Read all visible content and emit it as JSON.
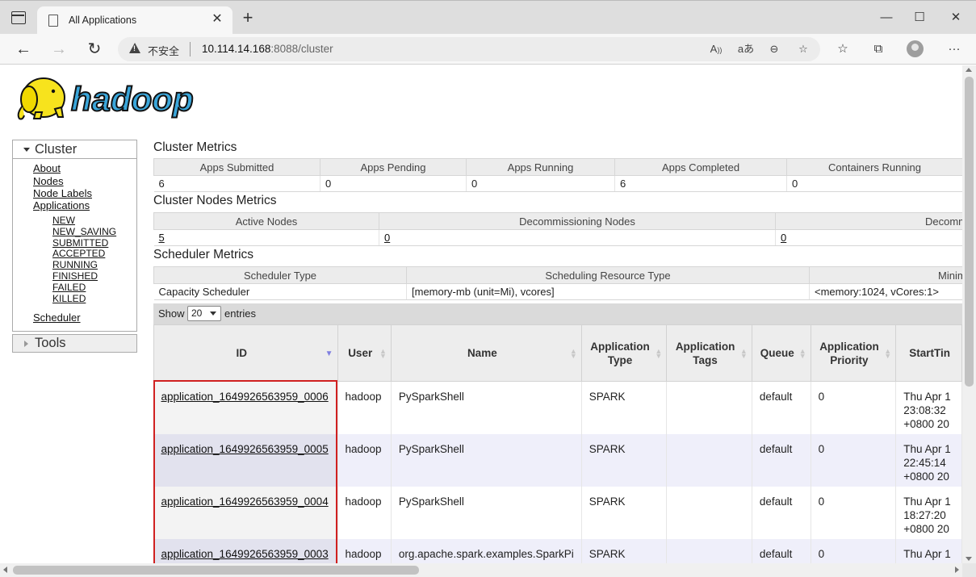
{
  "browser": {
    "tab_title": "All Applications",
    "insecure_label": "不安全",
    "url_host": "10.114.14.168",
    "url_rest": ":8088/cluster"
  },
  "logo_text": "hadoop",
  "nav": {
    "cluster_label": "Cluster",
    "links": [
      "About",
      "Nodes",
      "Node Labels",
      "Applications"
    ],
    "app_states": [
      "NEW",
      "NEW_SAVING",
      "SUBMITTED",
      "ACCEPTED",
      "RUNNING",
      "FINISHED",
      "FAILED",
      "KILLED"
    ],
    "scheduler": "Scheduler",
    "tools_label": "Tools"
  },
  "cluster_metrics": {
    "title": "Cluster Metrics",
    "headers": [
      "Apps Submitted",
      "Apps Pending",
      "Apps Running",
      "Apps Completed",
      "Containers Running"
    ],
    "values": [
      "6",
      "0",
      "0",
      "6",
      "0"
    ]
  },
  "cluster_nodes_metrics": {
    "title": "Cluster Nodes Metrics",
    "headers": [
      "Active Nodes",
      "Decommissioning Nodes",
      "Decommis"
    ],
    "values": [
      "5",
      "0",
      "0"
    ]
  },
  "scheduler_metrics": {
    "title": "Scheduler Metrics",
    "headers": [
      "Scheduler Type",
      "Scheduling Resource Type",
      "Minim"
    ],
    "values": [
      "Capacity Scheduler",
      "[memory-mb (unit=Mi), vcores]",
      "<memory:1024, vCores:1>"
    ]
  },
  "apps_toolbar": {
    "show_label": "Show",
    "page_size": "20",
    "entries_label": "entries"
  },
  "apps_table": {
    "headers": [
      "ID",
      "User",
      "Name",
      "Application Type",
      "Application Tags",
      "Queue",
      "Application Priority",
      "StartTin"
    ],
    "rows": [
      {
        "id": "application_1649926563959_0006",
        "user": "hadoop",
        "name": "PySparkShell",
        "type": "SPARK",
        "tags": "",
        "queue": "default",
        "priority": "0",
        "start1": "Thu Apr 1",
        "start2": "23:08:32",
        "start3": "+0800 20"
      },
      {
        "id": "application_1649926563959_0005",
        "user": "hadoop",
        "name": "PySparkShell",
        "type": "SPARK",
        "tags": "",
        "queue": "default",
        "priority": "0",
        "start1": "Thu Apr 1",
        "start2": "22:45:14",
        "start3": "+0800 20"
      },
      {
        "id": "application_1649926563959_0004",
        "user": "hadoop",
        "name": "PySparkShell",
        "type": "SPARK",
        "tags": "",
        "queue": "default",
        "priority": "0",
        "start1": "Thu Apr 1",
        "start2": "18:27:20",
        "start3": "+0800 20"
      },
      {
        "id": "application_1649926563959_0003",
        "user": "hadoop",
        "name": "org.apache.spark.examples.SparkPi",
        "type": "SPARK",
        "tags": "",
        "queue": "default",
        "priority": "0",
        "start1": "Thu Apr 1",
        "start2": "",
        "start3": ""
      }
    ]
  },
  "colors": {
    "highlight_border": "#d02020",
    "sort_active": "#7f7fe0",
    "logo_blue": "#3aa6da",
    "logo_yellow": "#f7e31d"
  }
}
